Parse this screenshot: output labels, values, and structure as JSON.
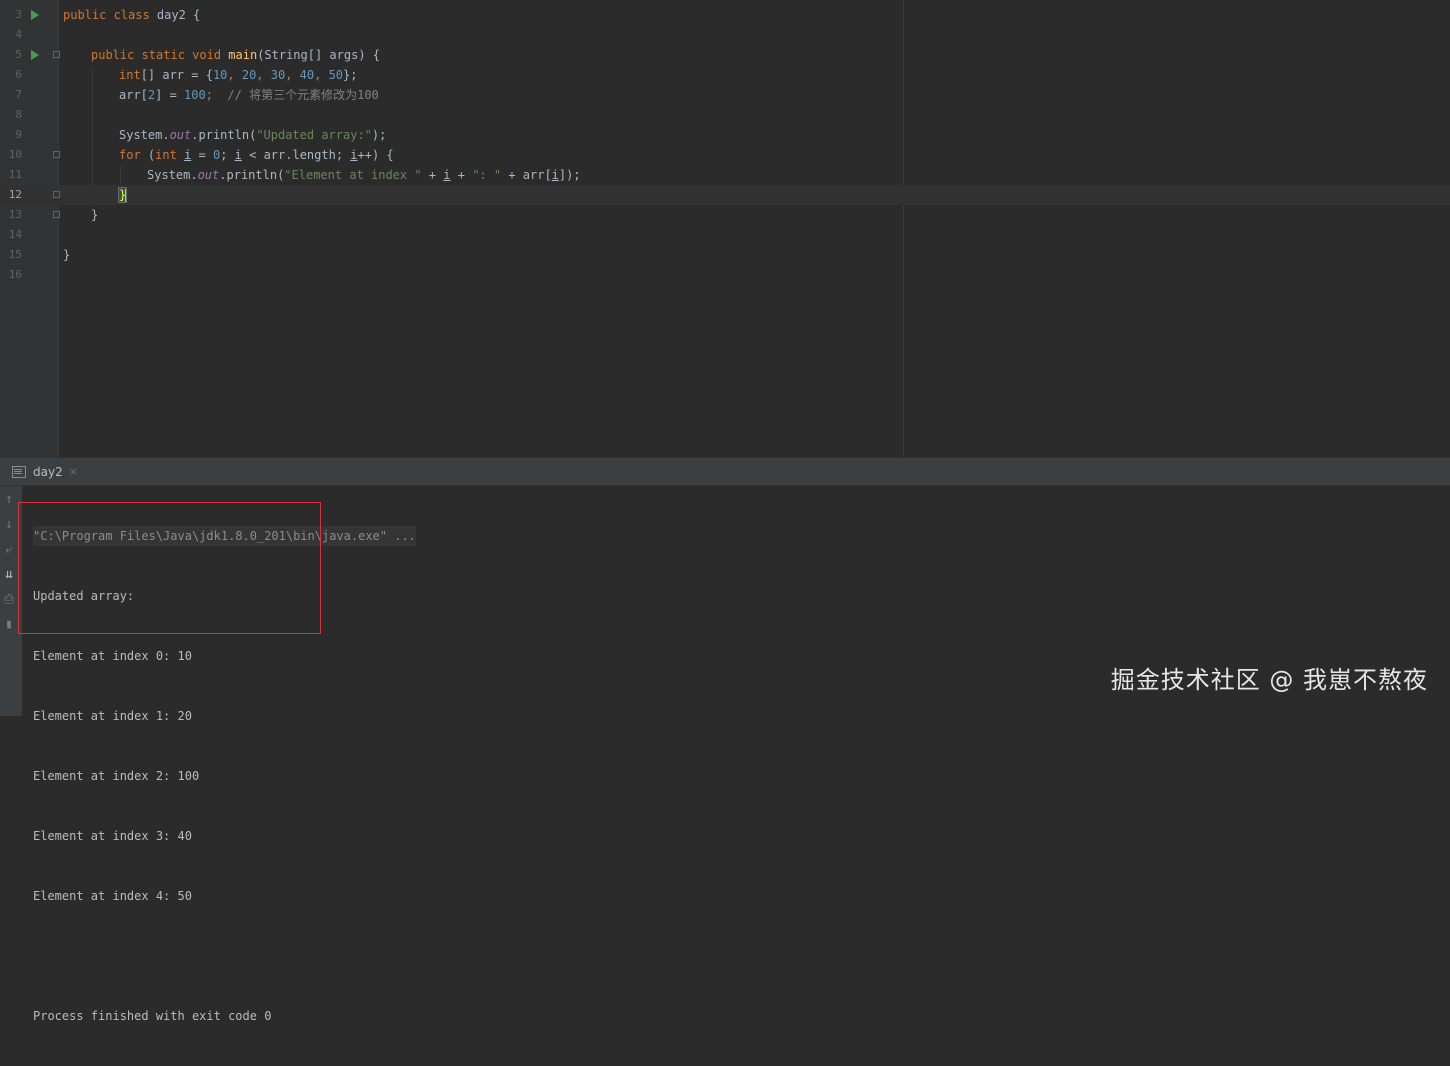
{
  "editor": {
    "lines": [
      {
        "n": "3"
      },
      {
        "n": "4"
      },
      {
        "n": "5"
      },
      {
        "n": "6"
      },
      {
        "n": "7"
      },
      {
        "n": "8"
      },
      {
        "n": "9"
      },
      {
        "n": "10"
      },
      {
        "n": "11"
      },
      {
        "n": "12"
      },
      {
        "n": "13"
      },
      {
        "n": "14"
      },
      {
        "n": "15"
      },
      {
        "n": "16"
      }
    ],
    "code": {
      "l3_kw": "public class",
      "l3_rest": " day2 {",
      "l5_kw": "public static void",
      "l5_fn": "main",
      "l5_rest": "(String[] args) {",
      "l6_kw": "int",
      "l6_a": "[] arr = {",
      "l6_n1": "10",
      "l6_n2": "20",
      "l6_n3": "30",
      "l6_n4": "40",
      "l6_n5": "50",
      "l6_end": "};",
      "l7_a": "arr[",
      "l7_n1": "2",
      "l7_b": "] = ",
      "l7_n2": "100",
      "l7_c": ";",
      "l7_cmt": "// 将第三个元素修改为100",
      "l9_a": "System.",
      "l9_fld": "out",
      "l9_b": ".println(",
      "l9_str": "\"Updated array:\"",
      "l9_c": ");",
      "l10_kw": "for",
      "l10_a": " (",
      "l10_kw2": "int",
      "l10_var1": "i",
      "l10_b": " = ",
      "l10_n": "0",
      "l10_c": "; ",
      "l10_var2": "i",
      "l10_d": " < arr.length; ",
      "l10_var3": "i",
      "l10_e": "++) {",
      "l11_a": "System.",
      "l11_fld": "out",
      "l11_b": ".println(",
      "l11_str1": "\"Element at index \"",
      "l11_c": " + ",
      "l11_var1": "i",
      "l11_d": " + ",
      "l11_str2": "\": \"",
      "l11_e": " + arr[",
      "l11_var2": "i",
      "l11_f": "]);",
      "l12": "}",
      "l13": "}",
      "l15": "}"
    }
  },
  "run_panel": {
    "tab_label": "day2",
    "tab_close": "×",
    "command": "\"C:\\Program Files\\Java\\jdk1.8.0_201\\bin\\java.exe\" ...",
    "output": [
      "Updated array:",
      "Element at index 0: 10",
      "Element at index 1: 20",
      "Element at index 2: 100",
      "Element at index 3: 40",
      "Element at index 4: 50"
    ],
    "exit": "Process finished with exit code 0"
  },
  "watermark": "掘金技术社区 @ 我崽不熬夜",
  "colors": {
    "keyword": "#cc7832",
    "number": "#6897bb",
    "string": "#6a8759",
    "comment": "#808080",
    "highlight_box": "#d9323a",
    "run_arrow": "#499c54"
  }
}
